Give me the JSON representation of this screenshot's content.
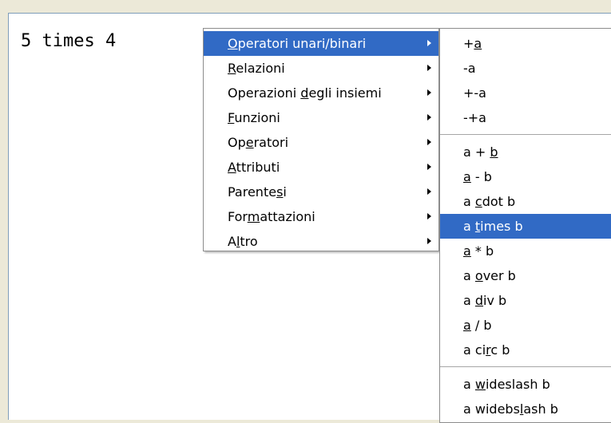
{
  "editor": {
    "text": "5 times 4"
  },
  "main_menu": {
    "items": [
      {
        "pre": "",
        "key": "O",
        "post": "peratori unari/binari",
        "highlighted": true
      },
      {
        "pre": "",
        "key": "R",
        "post": "elazioni",
        "highlighted": false
      },
      {
        "pre": "Operazioni ",
        "key": "d",
        "post": "egli insiemi",
        "highlighted": false
      },
      {
        "pre": "",
        "key": "F",
        "post": "unzioni",
        "highlighted": false
      },
      {
        "pre": "Op",
        "key": "e",
        "post": "ratori",
        "highlighted": false
      },
      {
        "pre": "",
        "key": "A",
        "post": "ttributi",
        "highlighted": false
      },
      {
        "pre": "Parente",
        "key": "s",
        "post": "i",
        "highlighted": false
      },
      {
        "pre": "For",
        "key": "m",
        "post": "attazioni",
        "highlighted": false
      },
      {
        "pre": "A",
        "key": "l",
        "post": "tro",
        "highlighted": false
      }
    ]
  },
  "sub_menu": {
    "groups": [
      [
        {
          "pre": "+",
          "key": "a",
          "post": ""
        },
        {
          "pre": "-a",
          "key": "",
          "post": ""
        },
        {
          "pre": "+-a",
          "key": "",
          "post": ""
        },
        {
          "pre": "-+a",
          "key": "",
          "post": ""
        }
      ],
      [
        {
          "pre": "a + ",
          "key": "b",
          "post": ""
        },
        {
          "pre": "",
          "key": "a",
          "post": " - b"
        },
        {
          "pre": "a ",
          "key": "c",
          "post": "dot b"
        },
        {
          "pre": "a ",
          "key": "t",
          "post": "imes b",
          "highlighted": true
        },
        {
          "pre": "",
          "key": "a",
          "post": " * b"
        },
        {
          "pre": "a ",
          "key": "o",
          "post": "ver b"
        },
        {
          "pre": "a ",
          "key": "d",
          "post": "iv b"
        },
        {
          "pre": "",
          "key": "a",
          "post": " / b"
        },
        {
          "pre": "a ci",
          "key": "r",
          "post": "c b"
        }
      ],
      [
        {
          "pre": "a ",
          "key": "w",
          "post": "ideslash b"
        },
        {
          "pre": "a widebs",
          "key": "l",
          "post": "ash b"
        }
      ]
    ]
  }
}
